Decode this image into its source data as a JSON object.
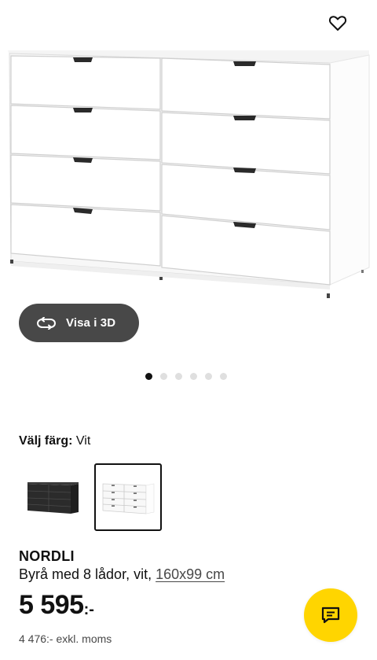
{
  "icons": {
    "favorite": "heart-outline-icon",
    "view3d": "rotate-3d-icon",
    "chat": "chat-bubble-icon"
  },
  "view3d": {
    "label": "Visa i 3D"
  },
  "carousel": {
    "total": 6,
    "active": 1
  },
  "color_selector": {
    "label": "Välj färg:",
    "value": "Vit",
    "options": [
      {
        "color": "black",
        "selected": false
      },
      {
        "color": "white",
        "selected": true
      }
    ]
  },
  "product": {
    "name": "NORDLI",
    "description": "Byrå med 8 lådor, vit,",
    "dimensions": "160x99 cm",
    "price_main": "5 595",
    "price_suffix": ":-",
    "price_excl": "4 476:- exkl. moms"
  },
  "colors": {
    "accent_yellow": "#FFD500",
    "button_dark": "#484848",
    "text": "#111111"
  }
}
